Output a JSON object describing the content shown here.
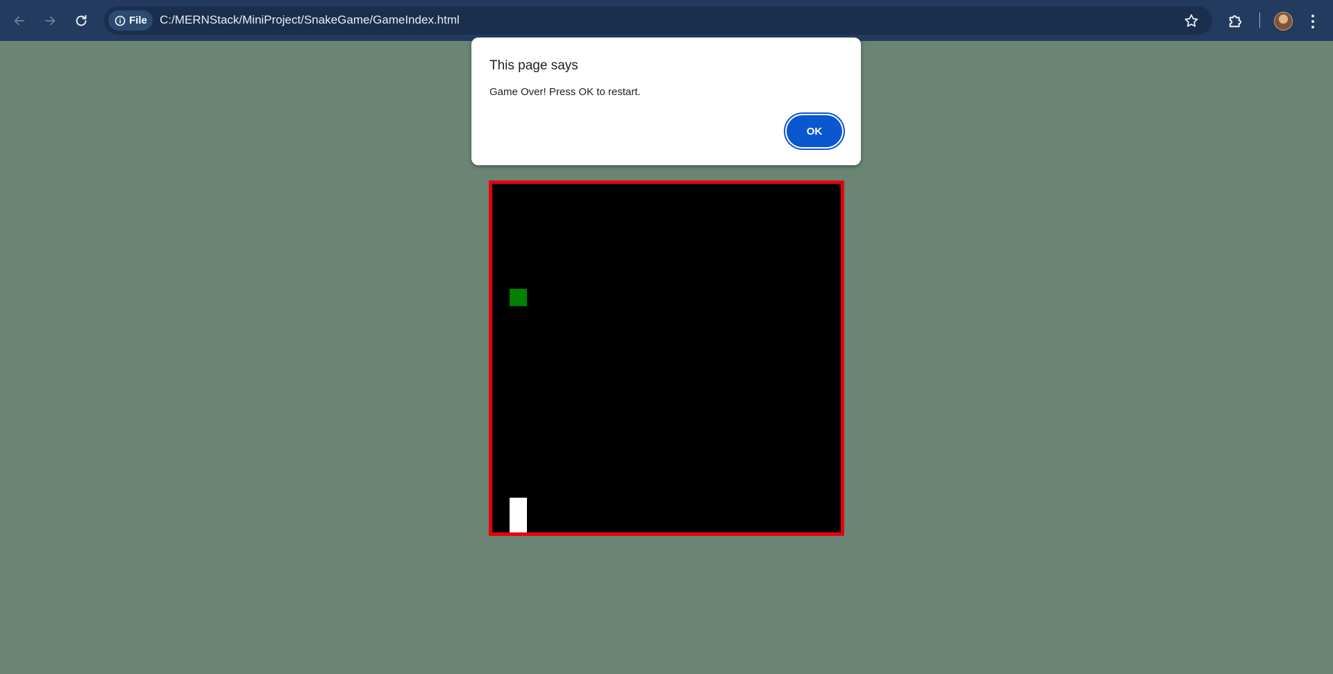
{
  "browser": {
    "chip_label": "File",
    "url": "C:/MERNStack/MiniProject/SnakeGame/GameIndex.html"
  },
  "dialog": {
    "title": "This page says",
    "message": "Game Over! Press OK to restart.",
    "ok_label": "OK"
  },
  "game": {
    "grid": 20,
    "food": {
      "col": 1,
      "row": 6
    },
    "snake": [
      {
        "col": 1,
        "row": 18
      },
      {
        "col": 1,
        "row": 19
      }
    ]
  },
  "colors": {
    "page_bg": "#6a8574",
    "board_border": "#e8000b",
    "board_bg": "#000000",
    "food": "#008000",
    "snake": "#ffffff",
    "ok_button": "#0b57d0"
  }
}
